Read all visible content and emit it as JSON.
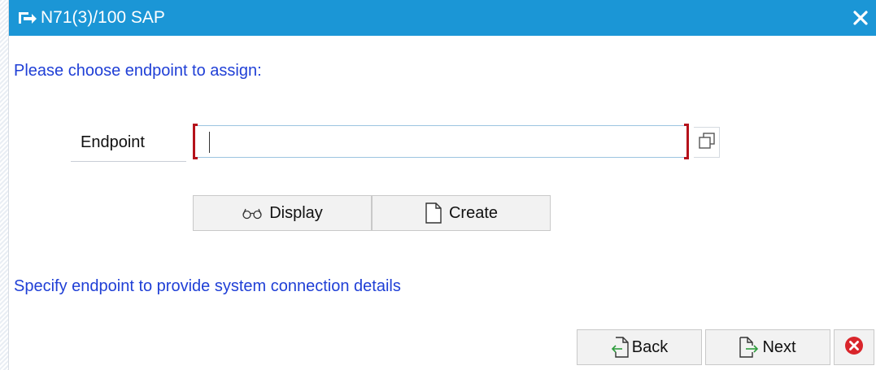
{
  "window": {
    "title": "N71(3)/100 SAP"
  },
  "dialog": {
    "prompt": "Please choose endpoint to assign:",
    "endpoint_label": "Endpoint",
    "endpoint_value": "",
    "display_label": "Display",
    "create_label": "Create",
    "hint": "Specify endpoint to provide system connection details",
    "back_label": "Back",
    "next_label": "Next"
  },
  "colors": {
    "title_bar": "#1b96d6",
    "info_text": "#1f3fd6",
    "required_bracket": "#b5121b",
    "cancel_icon": "#d9252b"
  },
  "icons": {
    "title": "dialog-arrow-icon",
    "close": "close-icon",
    "value_help": "value-help-icon",
    "display": "glasses-icon",
    "create": "new-document-icon",
    "back": "back-arrow-icon",
    "next": "next-arrow-icon",
    "cancel": "cancel-icon"
  }
}
